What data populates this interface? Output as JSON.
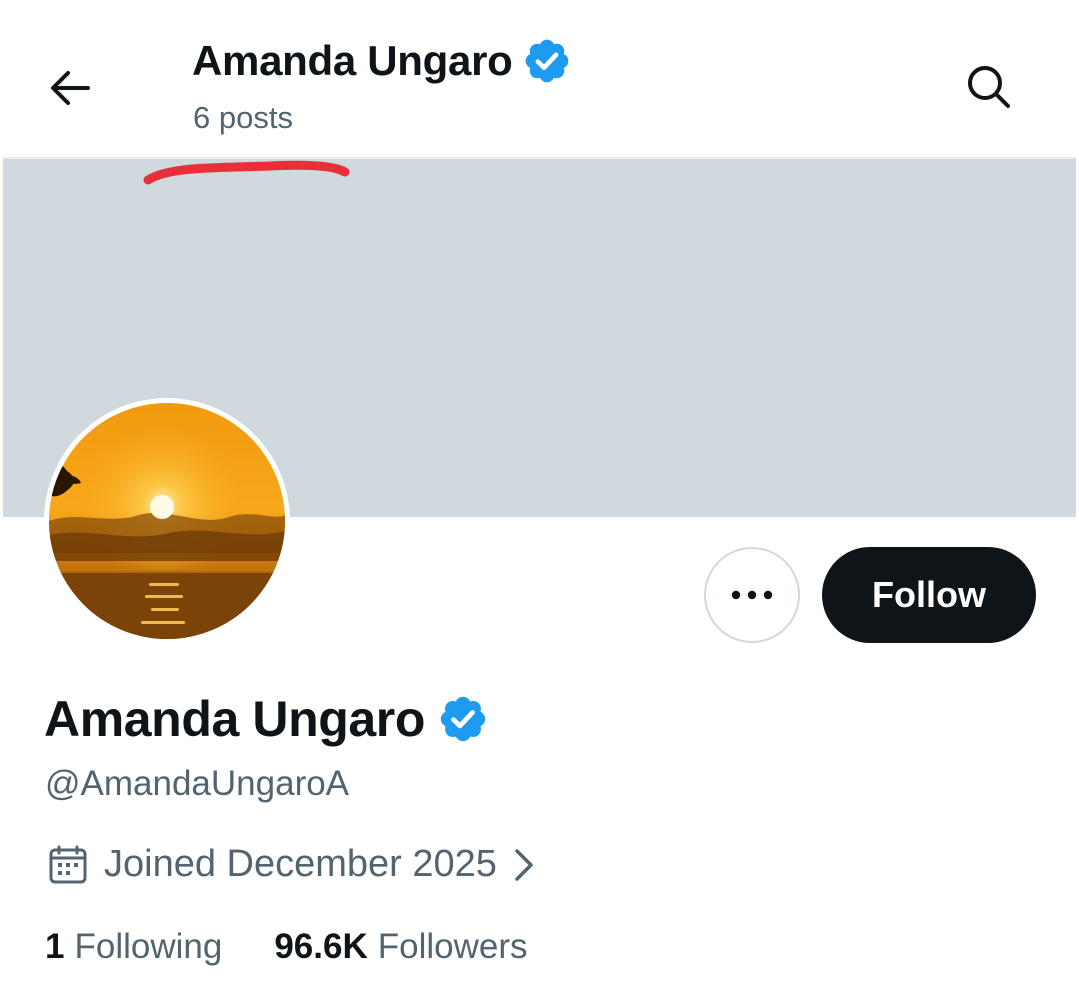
{
  "header": {
    "back_icon": "arrow-left-icon",
    "name": "Amanda Ungaro",
    "verified_icon": "verified-badge-icon",
    "posts": "6 posts",
    "search_icon": "search-icon"
  },
  "annotation": {
    "color": "#e8303a"
  },
  "banner": {
    "color": "#cfd9de"
  },
  "avatar": {
    "description": "sunset-over-ocean"
  },
  "actions": {
    "more_icon": "more-horizontal-icon",
    "follow_label": "Follow"
  },
  "profile": {
    "name": "Amanda Ungaro",
    "handle": "@AmandaUngaroA",
    "joined": "Joined December 2025",
    "joined_icon": "calendar-icon",
    "joined_chevron": "chevron-right-icon",
    "following_count": "1",
    "following_label": "Following",
    "followers_count": "96.6K",
    "followers_label": "Followers"
  },
  "colors": {
    "verified": "#1d9bf0",
    "text_primary": "#0f1419",
    "text_secondary": "#536471",
    "follow_bg": "#0f1419"
  }
}
